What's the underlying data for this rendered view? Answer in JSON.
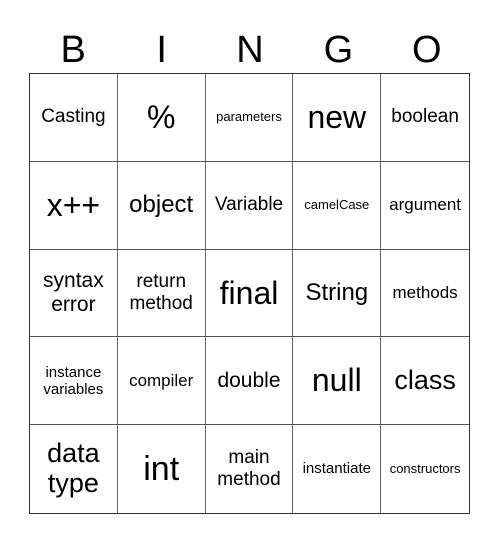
{
  "header": {
    "letters": [
      "B",
      "I",
      "N",
      "G",
      "O"
    ]
  },
  "cells": [
    "Casting",
    "%",
    "parameters",
    "new",
    "boolean",
    "x++",
    "object",
    "Variable",
    "camelCase",
    "argument",
    "syntax error",
    "return method",
    "final",
    "String",
    "methods",
    "instance variables",
    "compiler",
    "double",
    "null",
    "class",
    "data type",
    "int",
    "main method",
    "instantiate",
    "constructors"
  ]
}
